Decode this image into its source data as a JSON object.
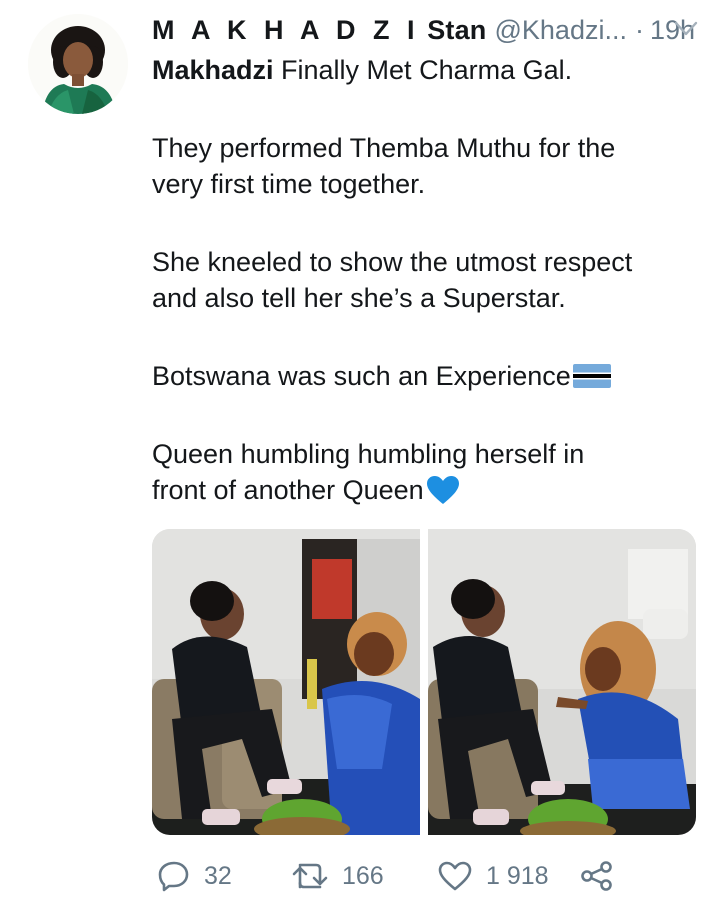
{
  "tweet": {
    "display_name_spaced": "M A K H A D Z I",
    "display_name_rest": "Stan",
    "handle": "@Khadzi...",
    "separator": "·",
    "time": "19h",
    "lines": {
      "l1_bold": "Makhadzi",
      "l1_rest": " Finally Met Charma Gal.",
      "l2": "They performed Themba Muthu for the",
      "l3": "very first time together.",
      "l4": "She kneeled to show the utmost respect",
      "l5": "and also tell her she’s a Superstar.",
      "l6": "Botswana was such an Experience",
      "l7": "Queen humbling humbling herself in",
      "l8": "front of another Queen"
    }
  },
  "actions": {
    "replies": "32",
    "retweets": "166",
    "likes": "1 918"
  },
  "icons": {
    "reply": "reply-icon",
    "retweet": "retweet-icon",
    "like": "heart-icon",
    "share": "share-icon",
    "caret": "chevron-down-icon",
    "flag": "botswana-flag-icon",
    "blue_heart": "blue-heart-icon"
  },
  "colors": {
    "text": "#14171a",
    "secondary": "#657786",
    "flag_blue": "#75AADB",
    "heart_blue": "#1d8fe1"
  }
}
